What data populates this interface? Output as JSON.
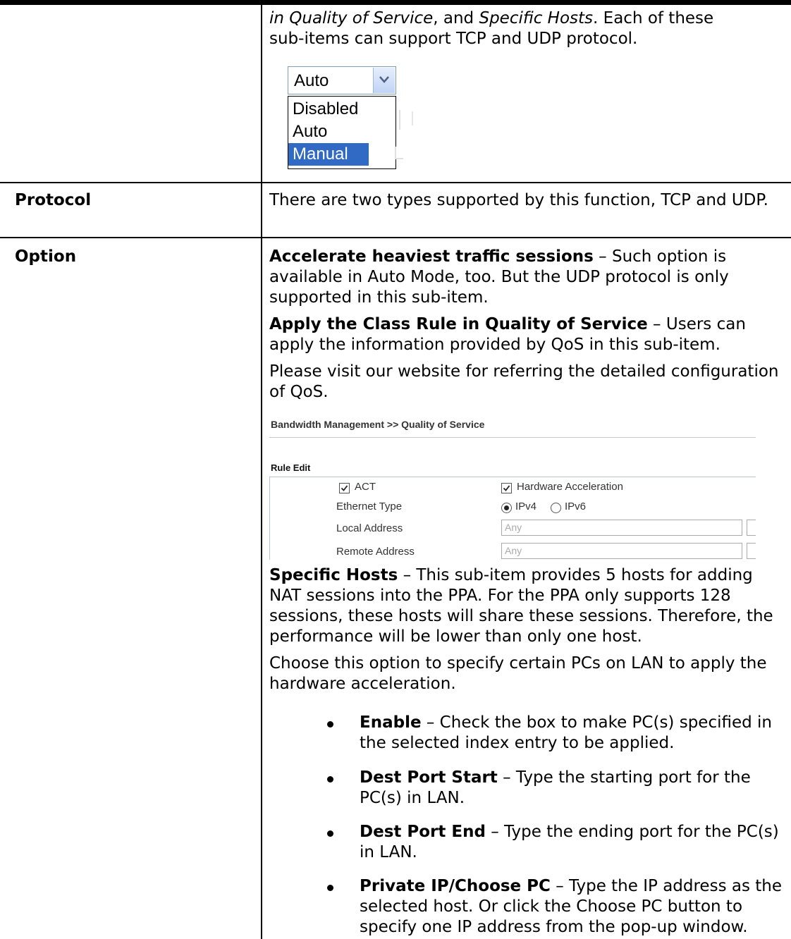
{
  "intro": {
    "line1_em1": "in Quality of Service",
    "line1_mid": ", and ",
    "line1_em2": "Specific Hosts",
    "line1_end": ". Each of these",
    "line2": "sub-items can support TCP and UDP protocol."
  },
  "dropdown": {
    "selected": "Auto",
    "options": [
      "Disabled",
      "Auto",
      "Manual"
    ],
    "highlighted": "Manual",
    "highlight_color": "#316ac5",
    "arrow_icon": "chevron-down-icon"
  },
  "rows": [
    {
      "label": "Protocol",
      "text": "There are two types supported by this function, TCP and UDP."
    },
    {
      "label": "Option",
      "p1_bold": "Accelerate heaviest traffic sessions",
      "p1_rest": " – Such option is available in Auto Mode, too. But the UDP protocol is only supported in this sub-item.",
      "p2_bold": "Apply the Class Rule in Quality of Service",
      "p2_rest": " – Users can apply the information provided by QoS in this sub-item.",
      "p3": "Please visit our website for referring the detailed configuration of QoS.",
      "p4_bold": "Specific Hosts",
      "p4_rest": " – This sub-item provides 5 hosts for adding NAT sessions into the PPA. For the PPA only supports 128 sessions, these hosts will share these sessions. Therefore, the performance will be lower than only one host.",
      "p5": "Choose this option to specify certain PCs on LAN to apply the hardware acceleration.",
      "bullets": [
        {
          "bold": "Enable",
          "rest": " – Check the box to make PC(s) specified in the selected index entry to be applied."
        },
        {
          "bold": "Dest Port Start",
          "rest": " – Type the starting port for the PC(s) in LAN."
        },
        {
          "bold": "Dest Port End",
          "rest": " – Type the ending port for the PC(s) in LAN."
        },
        {
          "bold": "Private IP/Choose PC",
          "rest": " – Type the IP address as the selected host. Or click the Choose PC button to specify one IP address from the pop-up window."
        }
      ]
    }
  ],
  "qos_screenshot": {
    "breadcrumb": "Bandwidth Management >> Quality of Service",
    "section": "Rule Edit",
    "act_label": "ACT",
    "hw_label": "Hardware Acceleration",
    "ethernet_type_label": "Ethernet Type",
    "ipv4_label": "IPv4",
    "ipv6_label": "IPv6",
    "local_address_label": "Local Address",
    "local_address_value": "Any",
    "remote_address_label": "Remote Address",
    "remote_address_value": "Any"
  }
}
